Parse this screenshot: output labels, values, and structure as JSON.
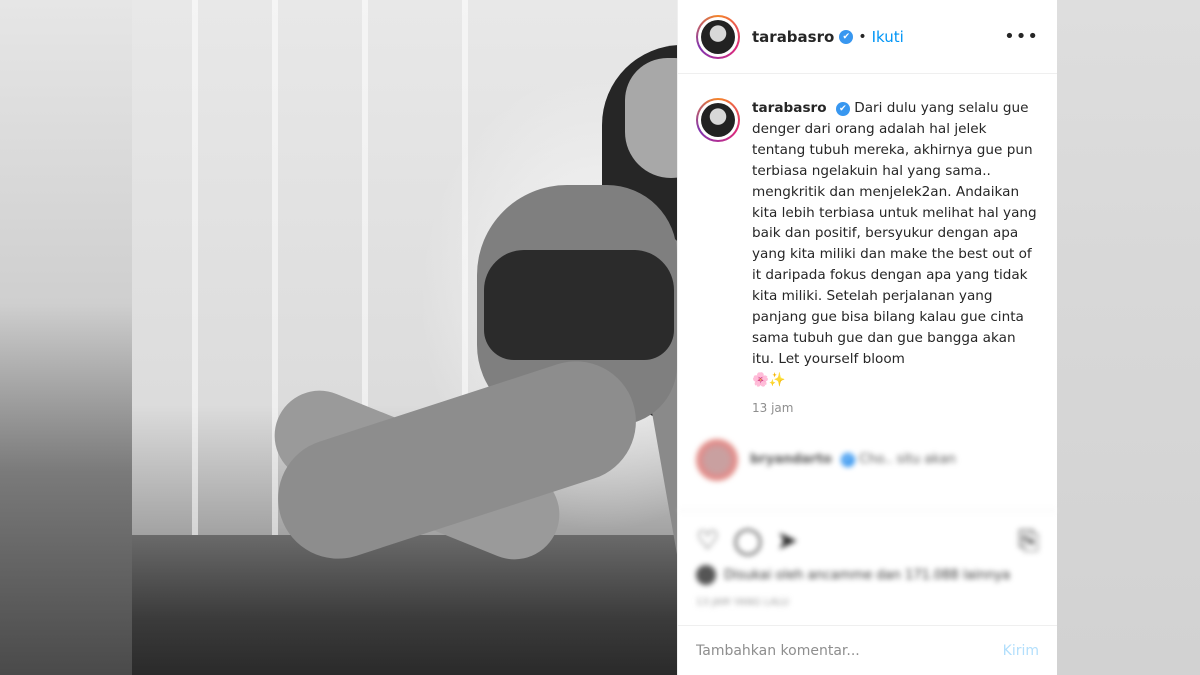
{
  "header": {
    "username": "tarabasro",
    "verified_glyph": "✔",
    "separator": "•",
    "follow_label": "Ikuti",
    "more_glyph": "•••"
  },
  "caption": {
    "username": "tarabasro",
    "text": "Dari dulu yang selalu gue denger dari orang adalah hal jelek tentang tubuh mereka, akhirnya gue pun terbiasa ngelakuin hal yang sama.. mengkritik dan menjelek2an. Andaikan kita lebih terbiasa untuk melihat hal yang baik dan positif, bersyukur dengan apa yang kita miliki dan make the best out of it daripada fokus dengan apa yang tidak kita miliki. Setelah perjalanan yang panjang gue bisa bilang kalau gue cinta sama tubuh gue dan gue bangga akan itu. Let yourself bloom",
    "emoji": "🌸✨",
    "time": "13 jam"
  },
  "comment": {
    "username": "bryandarto",
    "text": "Cho.. situ akan"
  },
  "actions": {
    "like_icon": "heart-icon",
    "comment_icon": "comment-icon",
    "share_icon": "share-icon",
    "save_icon": "bookmark-icon"
  },
  "likes": {
    "text": "Disukai oleh ancamme dan 171.088 lainnya"
  },
  "posted": "13 JAM YANG LALU",
  "add_comment": {
    "placeholder": "Tambahkan komentar...",
    "send_label": "Kirim"
  },
  "carousel": {
    "next_glyph": "›"
  }
}
